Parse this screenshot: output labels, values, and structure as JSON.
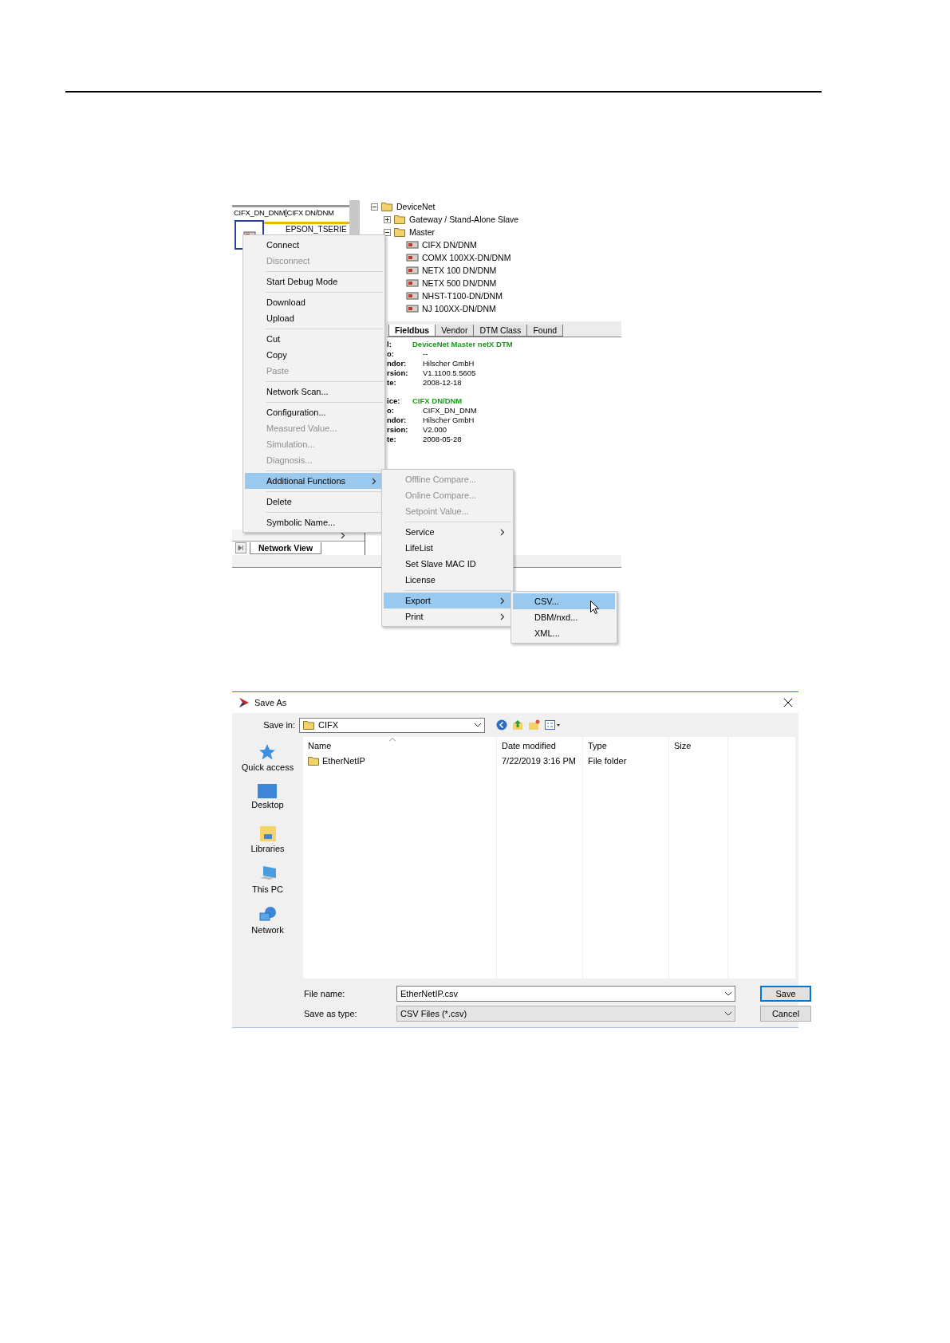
{
  "network_view": {
    "device_label": "CIFX_DN_DNM[CIFX DN/DNM",
    "slave_label": "EPSON_TSERIE",
    "tabs": [
      {
        "label": "Network View",
        "selected": true
      }
    ]
  },
  "tree": [
    {
      "label": "DeviceNet",
      "kind": "folder",
      "expanded": true,
      "children": [
        {
          "label": "Gateway / Stand-Alone Slave",
          "kind": "folder",
          "expanded": false
        },
        {
          "label": "Master",
          "kind": "folder",
          "expanded": true,
          "children": [
            {
              "label": "CIFX DN/DNM",
              "kind": "device"
            },
            {
              "label": "COMX 100XX-DN/DNM",
              "kind": "device"
            },
            {
              "label": "NETX 100 DN/DNM",
              "kind": "device"
            },
            {
              "label": "NETX 500 DN/DNM",
              "kind": "device"
            },
            {
              "label": "NHST-T100-DN/DNM",
              "kind": "device"
            },
            {
              "label": "NJ 100XX-DN/DNM",
              "kind": "device"
            }
          ]
        }
      ]
    }
  ],
  "catalog_tabs": [
    {
      "label": "Fieldbus",
      "selected": true
    },
    {
      "label": "Vendor",
      "selected": false
    },
    {
      "label": "DTM Class",
      "selected": false
    },
    {
      "label": "Found",
      "selected": false
    }
  ],
  "info": [
    {
      "heading_label": "l:",
      "heading": "DeviceNet Master netX DTM",
      "rows": [
        {
          "label": "o:",
          "value": "--"
        },
        {
          "label": "ndor:",
          "value": "Hilscher GmbH"
        },
        {
          "label": "rsion:",
          "value": "V1.1100.5.5605"
        },
        {
          "label": "te:",
          "value": "2008-12-18"
        }
      ]
    },
    {
      "heading_label": "ice:",
      "heading": "CIFX DN/DNM",
      "rows": [
        {
          "label": "o:",
          "value": "CIFX_DN_DNM"
        },
        {
          "label": "ndor:",
          "value": "Hilscher GmbH"
        },
        {
          "label": "rsion:",
          "value": "V2.000"
        },
        {
          "label": "te:",
          "value": "2008-05-28"
        }
      ]
    }
  ],
  "context_menu": {
    "groups": [
      [
        {
          "label": "Connect",
          "disabled": false,
          "selected": false,
          "submenu": false
        },
        {
          "label": "Disconnect",
          "disabled": true,
          "selected": false,
          "submenu": false
        }
      ],
      [
        {
          "label": "Start Debug Mode",
          "disabled": false,
          "selected": false,
          "submenu": false
        }
      ],
      [
        {
          "label": "Download",
          "disabled": false,
          "selected": false,
          "submenu": false
        },
        {
          "label": "Upload",
          "disabled": false,
          "selected": false,
          "submenu": false
        }
      ],
      [
        {
          "label": "Cut",
          "disabled": false,
          "selected": false,
          "submenu": false
        },
        {
          "label": "Copy",
          "disabled": false,
          "selected": false,
          "submenu": false
        },
        {
          "label": "Paste",
          "disabled": true,
          "selected": false,
          "submenu": false
        }
      ],
      [
        {
          "label": "Network Scan...",
          "disabled": false,
          "selected": false,
          "submenu": false
        }
      ],
      [
        {
          "label": "Configuration...",
          "disabled": false,
          "selected": false,
          "submenu": false
        },
        {
          "label": "Measured Value...",
          "disabled": true,
          "selected": false,
          "submenu": false
        },
        {
          "label": "Simulation...",
          "disabled": true,
          "selected": false,
          "submenu": false
        },
        {
          "label": "Diagnosis...",
          "disabled": true,
          "selected": false,
          "submenu": false
        }
      ],
      [
        {
          "label": "Additional Functions",
          "disabled": false,
          "selected": true,
          "submenu": true
        }
      ],
      [
        {
          "label": "Delete",
          "disabled": false,
          "selected": false,
          "submenu": false
        }
      ],
      [
        {
          "label": "Symbolic Name...",
          "disabled": false,
          "selected": false,
          "submenu": false
        }
      ]
    ]
  },
  "additional_menu": {
    "groups": [
      [
        {
          "label": "Offline Compare...",
          "disabled": true,
          "selected": false,
          "submenu": false
        },
        {
          "label": "Online Compare...",
          "disabled": true,
          "selected": false,
          "submenu": false
        },
        {
          "label": "Setpoint Value...",
          "disabled": true,
          "selected": false,
          "submenu": false
        }
      ],
      [
        {
          "label": "Service",
          "disabled": false,
          "selected": false,
          "submenu": true
        },
        {
          "label": "LifeList",
          "disabled": false,
          "selected": false,
          "submenu": false
        },
        {
          "label": "Set Slave MAC ID",
          "disabled": false,
          "selected": false,
          "submenu": false
        },
        {
          "label": "License",
          "disabled": false,
          "selected": false,
          "submenu": false
        }
      ],
      [
        {
          "label": "Export",
          "disabled": false,
          "selected": true,
          "submenu": true
        },
        {
          "label": "Print",
          "disabled": false,
          "selected": false,
          "submenu": true
        }
      ]
    ]
  },
  "export_menu": {
    "groups": [
      [
        {
          "label": "CSV...",
          "disabled": false,
          "selected": true,
          "submenu": false
        },
        {
          "label": "DBM/nxd...",
          "disabled": false,
          "selected": false,
          "submenu": false
        },
        {
          "label": "XML...",
          "disabled": false,
          "selected": false,
          "submenu": false
        }
      ]
    ]
  },
  "save_dialog": {
    "title": "Save As",
    "save_in_label": "Save in:",
    "save_in": "CIFX",
    "places": [
      {
        "label": "Quick access",
        "kind": "star"
      },
      {
        "label": "Desktop",
        "kind": "desktop"
      },
      {
        "label": "Libraries",
        "kind": "libraries"
      },
      {
        "label": "This PC",
        "kind": "computer"
      },
      {
        "label": "Network",
        "kind": "network"
      }
    ],
    "columns": [
      "Name",
      "Date modified",
      "Type",
      "Size"
    ],
    "rows": [
      {
        "name": "EtherNetIP",
        "date_modified": "7/22/2019 3:16 PM",
        "type": "File folder"
      }
    ],
    "file_name_label": "File name:",
    "file_name": "EtherNetIP.csv",
    "type_label": "Save as type:",
    "file_type": "CSV Files (*.csv)",
    "buttons": [
      {
        "label": "Save",
        "default": true
      },
      {
        "label": "Cancel",
        "default": false
      }
    ]
  }
}
